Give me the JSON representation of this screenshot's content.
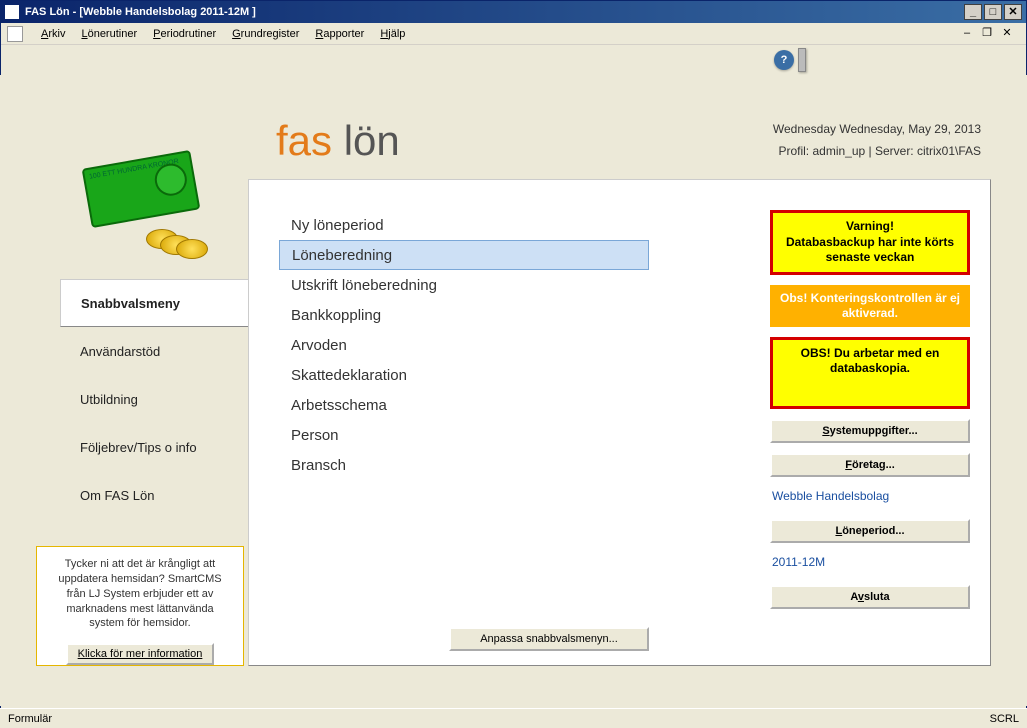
{
  "window": {
    "title": "FAS Lön - [Webble Handelsbolag 2011-12M ]"
  },
  "menu": {
    "items": [
      "Arkiv",
      "Lönerutiner",
      "Periodrutiner",
      "Grundregister",
      "Rapporter",
      "Hjälp"
    ]
  },
  "header": {
    "logo_fas": "fas",
    "logo_lon": " lön",
    "date": "Wednesday Wednesday, May 29, 2013",
    "profile": "Profil: admin_up  |  Server: citrix01\\FAS"
  },
  "side_tabs": {
    "t0": "Snabbvalsmeny",
    "t1": "Användarstöd",
    "t2": "Utbildning",
    "t3": "Följebrev/Tips o info",
    "t4": "Om FAS Lön"
  },
  "promo": {
    "text": "Tycker ni att det är krångligt att uppdatera hemsidan? SmartCMS från LJ System erbjuder ett av marknadens mest lättanvända system för hemsidor.",
    "button": "Klicka för mer information"
  },
  "quick": {
    "i0": "Ny löneperiod",
    "i1": "Löneberedning",
    "i2": "Utskrift löneberedning",
    "i3": "Bankkoppling",
    "i4": "Arvoden",
    "i5": "Skattedeklaration",
    "i6": "Arbetsschema",
    "i7": "Person",
    "i8": "Bransch",
    "customize": "Anpassa snabbvalsmenyn..."
  },
  "alerts": {
    "warn_title": "Varning!",
    "warn_body": "Databasbackup har inte körts senaste veckan",
    "obs_orange": "Obs! Konteringskontrollen är ej aktiverad.",
    "obs_yellow": "OBS! Du arbetar med en databaskopia."
  },
  "buttons": {
    "system": "Systemuppgifter...",
    "company": "Företag...",
    "period": "Löneperiod...",
    "quit": "Avsluta"
  },
  "links": {
    "company": "Webble Handelsbolag",
    "period": "2011-12M"
  },
  "status": {
    "left": "Formulär",
    "right": "SCRL"
  },
  "money_note_text": "100 ETT HUNDRA KRONOR"
}
